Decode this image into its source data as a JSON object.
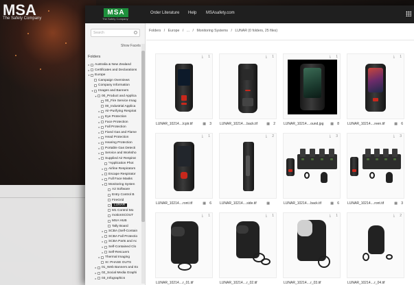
{
  "background": {
    "brand": "MSA",
    "tagline": "The Safety Company"
  },
  "topbar": {
    "logo": "MSA",
    "logo_tagline": "The Safety Company",
    "nav": [
      "Order Literature",
      "Help",
      "MSAsafety.com"
    ],
    "apps_icon": "grid-icon",
    "brand_color": "#1d8f3c"
  },
  "sidebar": {
    "search_placeholder": "Search",
    "show_facets": "Show Facets",
    "folders_title": "Folders",
    "tree": [
      {
        "label": "Australia & New Zealand",
        "toggle": "▸"
      },
      {
        "label": "Certificates and Declarations",
        "toggle": "▸"
      },
      {
        "label": "Europe",
        "toggle": "▾"
      },
      {
        "label": "Campaign Overviews",
        "toggle": ""
      },
      {
        "label": "Company Information",
        "toggle": ""
      },
      {
        "label": "Images and Banners",
        "toggle": "▾"
      },
      {
        "label": "00_Product and Applica",
        "toggle": "▾"
      },
      {
        "label": "00_Fire Service Imag",
        "toggle": ""
      },
      {
        "label": "00_Industrial Applica",
        "toggle": ""
      },
      {
        "label": "Air-Purifying Respirat",
        "toggle": "▸"
      },
      {
        "label": "Eye Protection",
        "toggle": "▸"
      },
      {
        "label": "Face Protection",
        "toggle": "▸"
      },
      {
        "label": "Fall Protection",
        "toggle": "▸"
      },
      {
        "label": "Fixed Gas and Flame",
        "toggle": "▸"
      },
      {
        "label": "Head Protection",
        "toggle": "▸"
      },
      {
        "label": "Hearing Protection",
        "toggle": "▸"
      },
      {
        "label": "Portable Gas Detecti",
        "toggle": "▸"
      },
      {
        "label": "Service and Worksho",
        "toggle": "▸"
      },
      {
        "label": "Supplied Air Respirat",
        "toggle": "▾"
      },
      {
        "label": "*Application Phot",
        "toggle": ""
      },
      {
        "label": "Airline Respirators",
        "toggle": "▸"
      },
      {
        "label": "Escape Respirator",
        "toggle": "▸"
      },
      {
        "label": "Full Face Masks",
        "toggle": "▸"
      },
      {
        "label": "Monitoring Systen",
        "toggle": "▾"
      },
      {
        "label": "A2 Software",
        "toggle": ""
      },
      {
        "label": "Entry Control B",
        "toggle": ""
      },
      {
        "label": "FireGrid",
        "toggle": ""
      },
      {
        "label": "LUNAR",
        "toggle": "",
        "selected": true
      },
      {
        "label": "M1 Control Mo",
        "toggle": ""
      },
      {
        "label": "motionSCOUT",
        "toggle": ""
      },
      {
        "label": "MSA HUB",
        "toggle": ""
      },
      {
        "label": "Tally Board",
        "toggle": ""
      },
      {
        "label": "SCBA (Self-Contain",
        "toggle": "▸"
      },
      {
        "label": "SCBA Fall Protectio",
        "toggle": "▸"
      },
      {
        "label": "SCBA Parts and Ac",
        "toggle": "▸"
      },
      {
        "label": "Self-Contained Clo",
        "toggle": "▸"
      },
      {
        "label": "Self-Rescuers",
        "toggle": "▸"
      },
      {
        "label": "Thermal Imaging",
        "toggle": "▸"
      },
      {
        "label": "XI: PHASE OUTS",
        "toggle": ""
      },
      {
        "label": "01_Web Banners and Ex",
        "toggle": "▸"
      },
      {
        "label": "02_Social Media Graphi",
        "toggle": "▸"
      },
      {
        "label": "03_Infographics",
        "toggle": "▸"
      }
    ]
  },
  "breadcrumb": [
    "Folders",
    "/",
    "Europe",
    "/",
    "...",
    "/",
    "Monitoring Systems",
    "/",
    "LUNAR (0 folders, 25 files)"
  ],
  "cards": [
    {
      "name": "LUNAR_10214....lcptr.tif",
      "downloads": "1",
      "views": "3"
    },
    {
      "name": "LUNAR_10214....back.tif",
      "downloads": "1",
      "views": "2"
    },
    {
      "name": "LUNAR_10214....ound.jpg",
      "downloads": "1",
      "views": "8"
    },
    {
      "name": "LUNAR_10214....reen.tif",
      "downloads": "1",
      "views": "6"
    },
    {
      "name": "LUNAR_10214....ront.tif",
      "downloads": "1",
      "views": "6"
    },
    {
      "name": "LUNAR_10214....side.tif",
      "downloads": "2",
      "views": ""
    },
    {
      "name": "LUNAR_10214....back.tif",
      "downloads": "3",
      "views": "6"
    },
    {
      "name": "LUNAR_10214....ront.tif",
      "downloads": "3",
      "views": "3"
    },
    {
      "name": "LUNAR_10214....r_01.tif",
      "downloads": "1",
      "views": ""
    },
    {
      "name": "LUNAR_10214....r_02.tif",
      "downloads": "1",
      "views": ""
    },
    {
      "name": "LUNAR_10214....r_03.tif",
      "downloads": "1",
      "views": ""
    },
    {
      "name": "LUNAR_10214....r_04.tif",
      "downloads": "2",
      "views": ""
    }
  ],
  "icons": {
    "download": "⤓",
    "views": "▦"
  }
}
